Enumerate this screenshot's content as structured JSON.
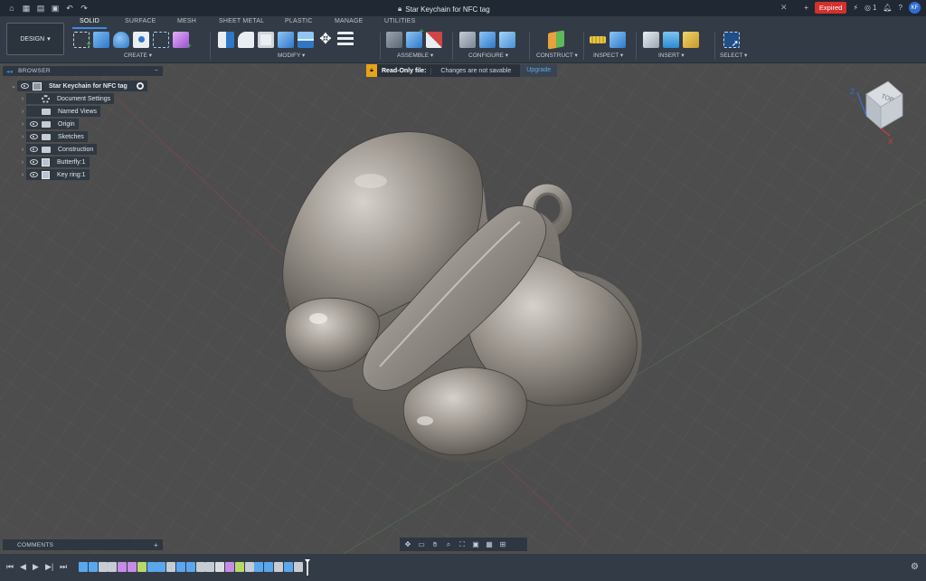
{
  "title_bar": {
    "document_title": "Star Keychain for NFC tag",
    "expired_badge": "Expired",
    "jobs_count": "1",
    "user_initials": "KF"
  },
  "tabs": [
    "SOLID",
    "SURFACE",
    "MESH",
    "SHEET METAL",
    "PLASTIC",
    "MANAGE",
    "UTILITIES"
  ],
  "active_tab": "SOLID",
  "workspace_button": "DESIGN",
  "ribbon_groups": {
    "create": "CREATE",
    "modify": "MODIFY",
    "assemble": "ASSEMBLE",
    "configure": "CONFIGURE",
    "construct": "CONSTRUCT",
    "inspect": "INSPECT",
    "insert": "INSERT",
    "select": "SELECT"
  },
  "readonly_banner": {
    "title": "Read-Only file:",
    "message": "Changes are not savable",
    "action": "Upgrade"
  },
  "browser": {
    "header": "BROWSER",
    "root": "Star Keychain for NFC tag",
    "items": [
      {
        "label": "Document Settings",
        "icon": "gear-icon",
        "eye": false
      },
      {
        "label": "Named Views",
        "icon": "folder-icon",
        "eye": false
      },
      {
        "label": "Origin",
        "icon": "folder-icon",
        "eye": true
      },
      {
        "label": "Sketches",
        "icon": "folder-icon",
        "eye": true
      },
      {
        "label": "Construction",
        "icon": "folder-icon",
        "eye": true
      },
      {
        "label": "Butterfly:1",
        "icon": "component-icon",
        "eye": true
      },
      {
        "label": "Key ring:1",
        "icon": "component-icon",
        "eye": true
      }
    ]
  },
  "comments_header": "COMMENTS",
  "view_cube": {
    "face_label": "TOP",
    "axis_z": "Z",
    "axis_x": "X"
  },
  "colors": {
    "accent": "#3b8be8",
    "expired": "#d4302c",
    "banner_warning": "#e8a317"
  }
}
